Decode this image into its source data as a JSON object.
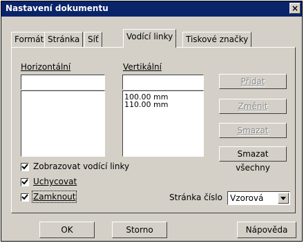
{
  "dialog": {
    "title": "Nastavení dokumentu",
    "close": "×"
  },
  "tabs": [
    {
      "label": "Formát"
    },
    {
      "label": "Stránka"
    },
    {
      "label": "Síť"
    },
    {
      "label": "Vodící linky"
    },
    {
      "label": "Tiskové značky"
    }
  ],
  "horizontal": {
    "label": "Horizontální",
    "input_value": "",
    "items": []
  },
  "vertical": {
    "label": "Vertikální",
    "input_value": "",
    "items": [
      "100.00 mm",
      "110.00 mm"
    ]
  },
  "buttons": {
    "add": "Přidat",
    "change": "Změnit",
    "delete": "Smazat",
    "delete_all": "Smazat všechny",
    "ok": "OK",
    "cancel": "Storno",
    "help": "Nápověda"
  },
  "checkboxes": [
    {
      "label": "Zobrazovat vodící linky",
      "checked": true
    },
    {
      "label": "Uchycovat",
      "checked": true
    },
    {
      "label": "Zamknout",
      "checked": true
    }
  ],
  "page": {
    "label": "Stránka číslo",
    "value": "Vzorová"
  }
}
